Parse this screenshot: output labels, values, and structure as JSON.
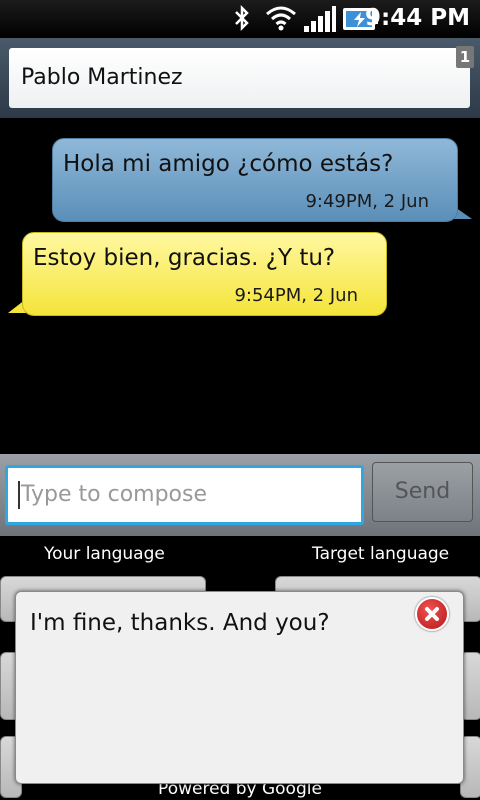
{
  "status_bar": {
    "time": "9:44 PM",
    "icons": [
      "bluetooth-icon",
      "wifi-icon",
      "signal-icon",
      "battery-charging-icon"
    ]
  },
  "header": {
    "recipient": "Pablo Martinez",
    "count_badge": "1"
  },
  "conversation": {
    "messages": [
      {
        "direction": "sent",
        "text": "Hola mi amigo ¿cómo estás?",
        "timestamp": "9:49PM, 2 Jun"
      },
      {
        "direction": "received",
        "text": "Estoy bien, gracias. ¿Y tu?",
        "timestamp": "9:54PM, 2 Jun"
      }
    ]
  },
  "compose": {
    "placeholder": "Type to compose",
    "send_label": "Send"
  },
  "translator": {
    "your_language_label": "Your language",
    "target_language_label": "Target language",
    "footer": "Powered by Google"
  },
  "popup": {
    "text": "I'm fine, thanks. And you?"
  },
  "colors": {
    "sent_bubble": "#6f9dc3",
    "received_bubble": "#f8ea5a",
    "compose_focus": "#2fa7e0",
    "close_button": "#c62828"
  }
}
